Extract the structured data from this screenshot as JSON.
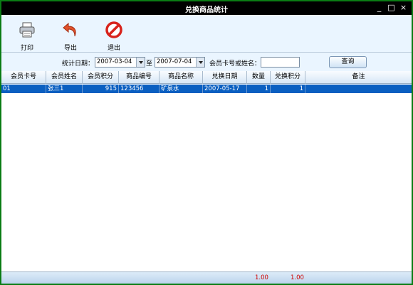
{
  "window": {
    "title": "兑换商品统计",
    "minimize": "_",
    "maximize": "□",
    "close": "×"
  },
  "toolbar": {
    "print_label": "打印",
    "export_label": "导出",
    "exit_label": "退出"
  },
  "filter": {
    "date_label": "统计日期：",
    "start_date": "2007-03-04",
    "to_label": "至",
    "end_date": "2007-07-04",
    "member_label": "会员卡号或姓名：",
    "member_value": "",
    "query_label": "查询"
  },
  "table": {
    "columns": [
      "会员卡号",
      "会员姓名",
      "会员积分",
      "商品编号",
      "商品名称",
      "兑换日期",
      "数量",
      "兑换积分",
      "备注"
    ],
    "rows": [
      {
        "card": "01",
        "name": "张三1",
        "points": "915",
        "code": "123456",
        "product": "矿泉水",
        "date": "2007-05-17",
        "qty": "1",
        "exchange_points": "1",
        "note": ""
      }
    ]
  },
  "footer": {
    "qty_total": "1.00",
    "points_total": "1.00"
  },
  "colors": {
    "border": "#0a7c14",
    "selection": "#0a5fc1",
    "total_text": "#d00000"
  }
}
